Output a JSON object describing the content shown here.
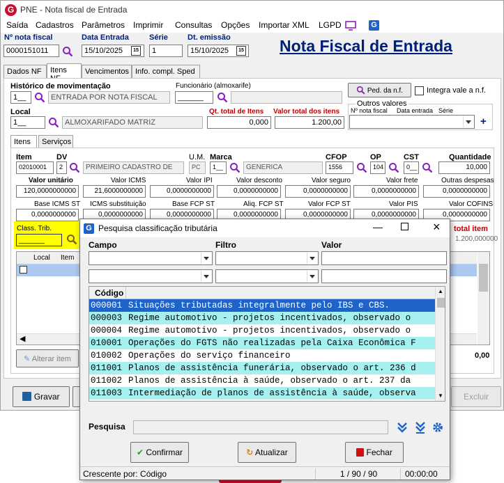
{
  "app": {
    "title": "PNE - Nota fiscal de Entrada"
  },
  "menu": [
    "Saída",
    "Cadastros",
    "Parâmetros",
    "Imprimir",
    "Consultas",
    "Opções",
    "Importar XML",
    "LGPD"
  ],
  "header": {
    "nota_label": "Nº nota fiscal",
    "nota_value": "0000151011",
    "data_label": "Data Entrada",
    "data_value": "15/10/2025",
    "serie_label": "Série",
    "serie_value": "1",
    "emissao_label": "Dt. emissão",
    "emissao_value": "15/10/2025",
    "big_title": "Nota Fiscal de Entrada"
  },
  "tabs": [
    "Dados NF",
    "Itens NF",
    "Vencimentos",
    "Info. compl. Sped"
  ],
  "itensnf": {
    "hist_label": "Histórico de movimentação",
    "hist_code": "1__",
    "hist_desc": "ENTRADA POR NOTA FISCAL",
    "func_label": "Funcionário (almoxarife)",
    "func_code": "______",
    "ped_button": "Ped. da n.f.",
    "integra_label": "Integra vale a n.f.",
    "local_label": "Local",
    "local_code": "1__",
    "local_desc": "ALMOXARIFADO MATRIZ",
    "qt_total_label": "Qt. total de Itens",
    "qt_total_value": "0,000",
    "valor_total_label": "Valor total dos itens",
    "valor_total_value": "1.200,00",
    "outros_label": "Outros valores",
    "outros_col1": "Nº nota fiscal",
    "outros_col2": "Data entrada",
    "outros_col3": "Série"
  },
  "subtabs": [
    "Itens",
    "Serviços"
  ],
  "item": {
    "item_label": "Item",
    "item_value": "02010001",
    "dv_label": "DV",
    "dv_value": "2",
    "dv_desc": "PRIMEIRO CADASTRO DE",
    "um_label": "U.M.",
    "um_value": "PC",
    "marca_label": "Marca",
    "marca_code": "1__",
    "marca_desc": "GENERICA",
    "cfop_label": "CFOP",
    "cfop_value": "1556",
    "op_label": "OP",
    "op_value": "104",
    "cst_label": "CST",
    "cst_value": "0__",
    "qtd_label": "Quantidade",
    "qtd_value": "10,000"
  },
  "valores1": [
    {
      "label": "Valor unitário",
      "value": "120,0000000000"
    },
    {
      "label": "Valor ICMS",
      "value": "21,6000000000"
    },
    {
      "label": "Valor IPI",
      "value": "0,0000000000"
    },
    {
      "label": "Valor desconto",
      "value": "0,0000000000"
    },
    {
      "label": "Valor seguro",
      "value": "0,0000000000"
    },
    {
      "label": "Valor frete",
      "value": "0,0000000000"
    },
    {
      "label": "Outras despesas",
      "value": "0,0000000000"
    }
  ],
  "valores2": [
    {
      "label": "Base ICMS ST",
      "value": "0,0000000000"
    },
    {
      "label": "ICMS substituição",
      "value": "0,0000000000"
    },
    {
      "label": "Base FCP ST",
      "value": "0,0000000000"
    },
    {
      "label": "Aliq. FCP ST",
      "value": "0,0000000000"
    },
    {
      "label": "Valor FCP ST",
      "value": "0,0000000000"
    },
    {
      "label": "Valor PIS",
      "value": "0,0000000000"
    },
    {
      "label": "Valor COFINS",
      "value": "0,0000000000"
    }
  ],
  "class_trib": {
    "label": "Class. Trib.",
    "value": "______"
  },
  "bg_grid": {
    "col_local": "Local",
    "col_item": "Item",
    "total_item": "total item",
    "total_value": "1.200,000000",
    "foot_value": "0,00"
  },
  "bottom": {
    "alterar": "Alterar item",
    "gravar": "Gravar",
    "excluir": "Excluir"
  },
  "dialog": {
    "title": "Pesquisa classificação tributária",
    "campo_label": "Campo",
    "filtro_label": "Filtro",
    "valor_label": "Valor",
    "grid_header": "Código",
    "rows": [
      {
        "code": "000001",
        "desc": "Situações tributadas integralmente pelo IBS e CBS."
      },
      {
        "code": "000003",
        "desc": "Regime automotivo - projetos incentivados, observado o"
      },
      {
        "code": "000004",
        "desc": "Regime automotivo - projetos incentivados, observado o"
      },
      {
        "code": "010001",
        "desc": "Operações do FGTS não realizadas pela Caixa Econômica F"
      },
      {
        "code": "010002",
        "desc": "Operações do serviço financeiro"
      },
      {
        "code": "011001",
        "desc": "Planos de assistência funerária, observado o art. 236 d"
      },
      {
        "code": "011002",
        "desc": "Planos de assistência à saúde, observado o art. 237 da"
      },
      {
        "code": "011003",
        "desc": "Intermediação de planos de assistência à saúde, observa"
      }
    ],
    "pesquisa_label": "Pesquisa",
    "confirmar": "Confirmar",
    "atualizar": "Atualizar",
    "fechar": "Fechar",
    "status_order": "Crescente por: Código",
    "status_count": "1 / 90 / 90",
    "status_time": "00:00:00"
  },
  "colors": {
    "accent": "#00207a",
    "selected": "#1e64c8",
    "alt_row": "#a6f0f0",
    "highlight": "#ffff00"
  }
}
